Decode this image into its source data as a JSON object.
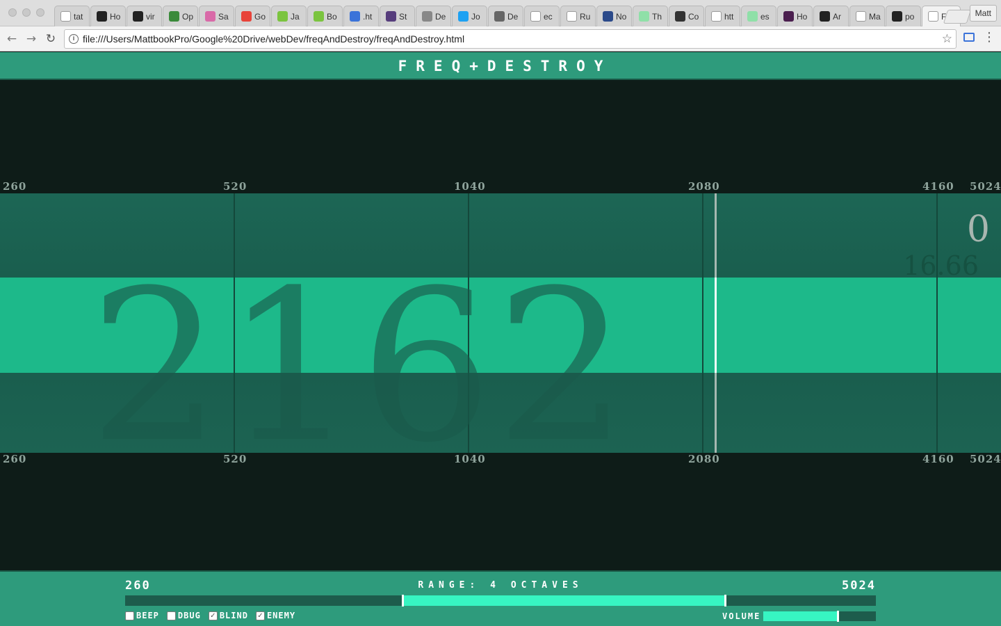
{
  "browser": {
    "tabs": [
      {
        "label": "tat",
        "icon": "document-icon",
        "color": "#ffffff"
      },
      {
        "label": "Ho",
        "icon": "hacker-icon",
        "color": "#222222"
      },
      {
        "label": "vir",
        "icon": "github-icon",
        "color": "#222222"
      },
      {
        "label": "Op",
        "icon": "gear-icon",
        "color": "#3a8a3a"
      },
      {
        "label": "Sa",
        "icon": "pattern-icon",
        "color": "#d96aa8"
      },
      {
        "label": "Go",
        "icon": "red-circle-icon",
        "color": "#e8433a"
      },
      {
        "label": "Ja",
        "icon": "green-icon",
        "color": "#7bc43f"
      },
      {
        "label": "Bo",
        "icon": "green-icon",
        "color": "#7bc43f"
      },
      {
        "label": ".ht",
        "icon": "wave-icon",
        "color": "#3b73d9"
      },
      {
        "label": "St",
        "icon": "bootstrap-icon",
        "color": "#563d7c"
      },
      {
        "label": "De",
        "icon": "reddit-icon",
        "color": "#888888"
      },
      {
        "label": "Jo",
        "icon": "twitter-icon",
        "color": "#1da1f2"
      },
      {
        "label": "De",
        "icon": "pattern-icon",
        "color": "#666666"
      },
      {
        "label": "ec",
        "icon": "document-icon",
        "color": "#ffffff"
      },
      {
        "label": "Ru",
        "icon": "wikipedia-icon",
        "color": "#ffffff"
      },
      {
        "label": "No",
        "icon": "cs-icon",
        "color": "#2b4a8a"
      },
      {
        "label": "Th",
        "icon": "pattern-icon",
        "color": "#8fe0a8"
      },
      {
        "label": "Co",
        "icon": "avatar-icon",
        "color": "#333333"
      },
      {
        "label": "htt",
        "icon": "document-icon",
        "color": "#ffffff"
      },
      {
        "label": "es",
        "icon": "pattern-icon",
        "color": "#8fe0a8"
      },
      {
        "label": "Ho",
        "icon": "a-icon",
        "color": "#4b1f4f"
      },
      {
        "label": "Ar",
        "icon": "github-icon",
        "color": "#222222"
      },
      {
        "label": "Ma",
        "icon": "document-icon",
        "color": "#ffffff"
      },
      {
        "label": "po",
        "icon": "github-icon",
        "color": "#222222"
      },
      {
        "label": "F",
        "icon": "speaker-icon",
        "color": "#ffffff",
        "active": true
      }
    ],
    "profile": "Matt",
    "url": "file:///Users/MattbookPro/Google%20Drive/webDev/freqAndDestroy/freqAndDestroy.html"
  },
  "game": {
    "title": "FREQ+DESTROY",
    "axis_labels": [
      "260",
      "520",
      "1040",
      "2080",
      "4160",
      "5024"
    ],
    "current_freq": "2162",
    "score": "0",
    "timer": "16.66",
    "colors": {
      "header": "#2e9b7c",
      "target_band": "#1db98a",
      "field": "#1b6150",
      "background": "#0e1c18"
    }
  },
  "controls": {
    "min": "260",
    "max": "5024",
    "range_text": "RANGE: 4 OCTAVES",
    "range_start_fraction": 0.369,
    "range_end_fraction": 0.8,
    "volume_label": "VOLUME",
    "volume_fraction": 0.66,
    "checkboxes": [
      {
        "label": "BEEP",
        "checked": false
      },
      {
        "label": "DBUG",
        "checked": false
      },
      {
        "label": "BLIND",
        "checked": true
      },
      {
        "label": "ENEMY",
        "checked": true
      }
    ]
  }
}
